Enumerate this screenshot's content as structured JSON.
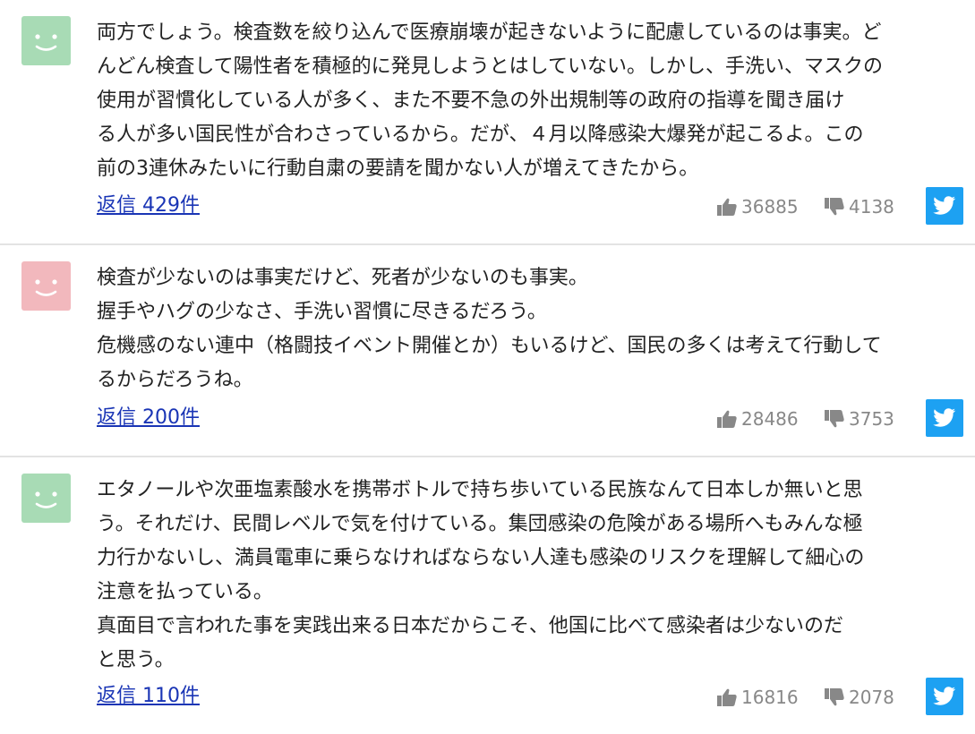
{
  "comments": [
    {
      "avatar_color": "#a8dbb5",
      "avatar_face": "smile-face-icon",
      "lines": [
        "両方でしょう。検査数を絞り込んで医療崩壊が起きないように配慮しているのは事実。ど",
        "んどん検査して陽性者を積極的に発見しようとはしていない。しかし、手洗い、マスクの",
        "使用が習慣化している人が多く、また不要不急の外出規制等の政府の指導を聞き届け",
        "る人が多い国民性が合わさっているから。だが、４月以降感染大爆発が起こるよ。この",
        "前の3連休みたいに行動自粛の要請を聞かない人が増えてきたから。"
      ],
      "reply_label": "返信 429件",
      "likes": "36885",
      "dislikes": "4138"
    },
    {
      "avatar_color": "#f2b8bd",
      "avatar_face": "smile-face-icon",
      "lines": [
        "検査が少ないのは事実だけど、死者が少ないのも事実。",
        "握手やハグの少なさ、手洗い習慣に尽きるだろう。",
        "危機感のない連中（格闘技イベント開催とか）もいるけど、国民の多くは考えて行動して",
        "るからだろうね。"
      ],
      "reply_label": "返信 200件",
      "likes": "28486",
      "dislikes": "3753"
    },
    {
      "avatar_color": "#a8dbb5",
      "avatar_face": "smile-face-icon",
      "lines": [
        "エタノールや次亜塩素酸水を携帯ボトルで持ち歩いている民族なんて日本しか無いと思",
        "う。それだけ、民間レベルで気を付けている。集団感染の危険がある場所へもみんな極",
        "力行かないし、満員電車に乗らなければならない人達も感染のリスクを理解して細心の",
        "注意を払っている。",
        "真面目で言われた事を実践出来る日本だからこそ、他国に比べて感染者は少ないのだ",
        "と思う。"
      ],
      "reply_label": "返信 110件",
      "likes": "16816",
      "dislikes": "2078"
    }
  ],
  "icons": {
    "like": "thumbs-up-icon",
    "dislike": "thumbs-down-icon",
    "share": "twitter-icon"
  },
  "colors": {
    "link": "#1a35b5",
    "twitter": "#1da1f2",
    "vote_text": "#888888"
  }
}
